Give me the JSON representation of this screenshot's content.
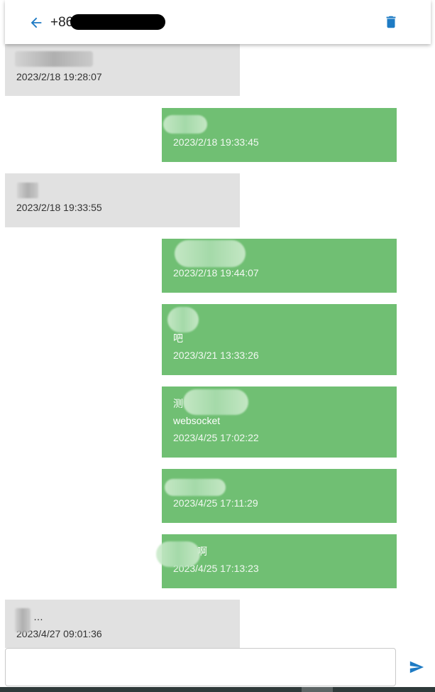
{
  "header": {
    "title": "+86",
    "back_icon": "arrow-left-icon",
    "delete_icon": "trash-icon",
    "accent_color": "#1e7bc4"
  },
  "messages": [
    {
      "direction": "in",
      "text": "",
      "time": "2023/2/18 19:28:07"
    },
    {
      "direction": "out",
      "text": "",
      "time": "2023/2/18 19:33:45"
    },
    {
      "direction": "in",
      "text": "",
      "time": "2023/2/18 19:33:55"
    },
    {
      "direction": "out",
      "text": "",
      "time": "2023/2/18 19:44:07"
    },
    {
      "direction": "out",
      "text": "\n吧",
      "time": "2023/3/21 13:33:26"
    },
    {
      "direction": "out",
      "text": "测\nwebsocket",
      "time": "2023/4/25 17:02:22"
    },
    {
      "direction": "out",
      "text": "",
      "time": "2023/4/25 17:11:29"
    },
    {
      "direction": "out",
      "text": "啊",
      "time": "2023/4/25 17:13:23"
    },
    {
      "direction": "in",
      "text": "…",
      "time": "2023/4/27 09:01:36"
    }
  ],
  "input": {
    "placeholder": "",
    "value": ""
  },
  "send_icon": "send-icon",
  "colors": {
    "incoming_bubble": "#e1e1e1",
    "outgoing_bubble": "#70bf73",
    "send_icon": "#1e7bc4"
  }
}
